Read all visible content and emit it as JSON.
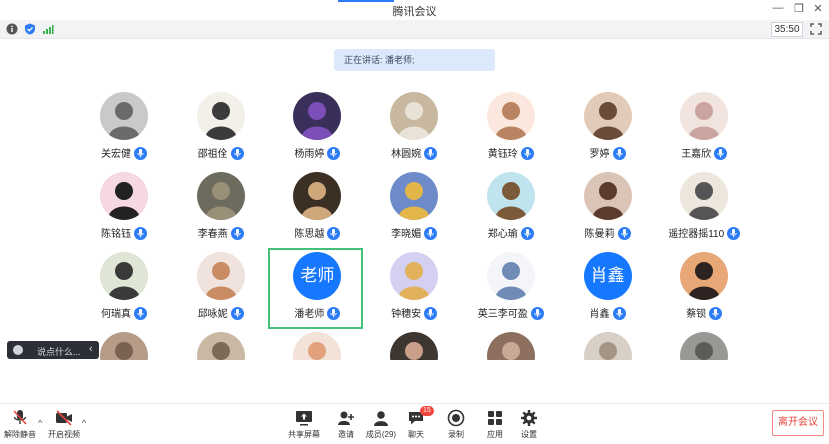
{
  "window": {
    "title": "腾讯会议",
    "controls": [
      "—",
      "❐",
      "✕"
    ]
  },
  "statusbar": {
    "timer": "35:50"
  },
  "speaking": {
    "text": "正在讲话: 潘老师;"
  },
  "participants": [
    {
      "name": "关宏健",
      "bg": "#c9c9c9",
      "fg": "#6b6b6b"
    },
    {
      "name": "邵祖佺",
      "bg": "#f3f0ea",
      "fg": "#3b3b3b"
    },
    {
      "name": "杨雨婷",
      "bg": "#3a2f5a",
      "fg": "#7c4fb8"
    },
    {
      "name": "林圆婉",
      "bg": "#c8b8a0",
      "fg": "#e9e2d6"
    },
    {
      "name": "黄钰玲",
      "bg": "#fbe7de",
      "fg": "#b88462"
    },
    {
      "name": "罗婷",
      "bg": "#e2ccb9",
      "fg": "#6a4b3a"
    },
    {
      "name": "王嘉欣",
      "bg": "#f1e3de",
      "fg": "#caa4a0"
    },
    {
      "name": "陈铭钰",
      "bg": "#f6d7e4",
      "fg": "#222222"
    },
    {
      "name": "李春燕",
      "bg": "#6d6a5e",
      "fg": "#9a8f77"
    },
    {
      "name": "陈思越",
      "bg": "#3c3025",
      "fg": "#cfa77b"
    },
    {
      "name": "李晓媚",
      "bg": "#6c8bc8",
      "fg": "#e3b64a"
    },
    {
      "name": "郑心瑜",
      "bg": "#bfe4ee",
      "fg": "#7b5a3a"
    },
    {
      "name": "陈曼莉",
      "bg": "#d9c4b6",
      "fg": "#5a3b2e"
    },
    {
      "name": "遥控器摇110",
      "bg": "#ece6dd",
      "fg": "#555555"
    },
    {
      "name": "何瑞真",
      "bg": "#dfe6d5",
      "fg": "#3a3a3a"
    },
    {
      "name": "邱咏妮",
      "bg": "#f0e2dc",
      "fg": "#c98b64"
    },
    {
      "name": "潘老师",
      "avatar_text": "老师",
      "host": true
    },
    {
      "name": "钟穗安",
      "bg": "#d4d0f2",
      "fg": "#e1b15b"
    },
    {
      "name": "英三李可盈",
      "bg": "#f3f5f8",
      "fg": "#6f8bb6"
    },
    {
      "name": "肖鑫",
      "avatar_text": "肖鑫"
    },
    {
      "name": "蔡钡",
      "bg": "#e8a777",
      "fg": "#2e2320"
    },
    {
      "name": "",
      "bg": "#b69b88",
      "fg": "#7a6252"
    },
    {
      "name": "",
      "bg": "#c9b8a4",
      "fg": "#7b6a55"
    },
    {
      "name": "",
      "bg": "#f3e2d8",
      "fg": "#e3a07c"
    },
    {
      "name": "",
      "bg": "#3e3631",
      "fg": "#caa08a"
    },
    {
      "name": "",
      "bg": "#8d6f60",
      "fg": "#c9a996"
    },
    {
      "name": "",
      "bg": "#d8cfc6",
      "fg": "#a59585"
    },
    {
      "name": "",
      "bg": "#9a9894",
      "fg": "#5e5c58"
    }
  ],
  "chat": {
    "placeholder": "说点什么..."
  },
  "toolbar": {
    "unmute": "解除静音",
    "video": "开启视频",
    "share": "共享屏幕",
    "invite": "邀请",
    "members": "成员(29)",
    "chat": "聊天",
    "chat_badge": "15",
    "record": "录制",
    "apps": "应用",
    "settings": "设置",
    "leave": "离开会议"
  },
  "colors": {
    "accent": "#2b7cf6",
    "host_border": "#43c07a",
    "leave": "#e8453c"
  }
}
